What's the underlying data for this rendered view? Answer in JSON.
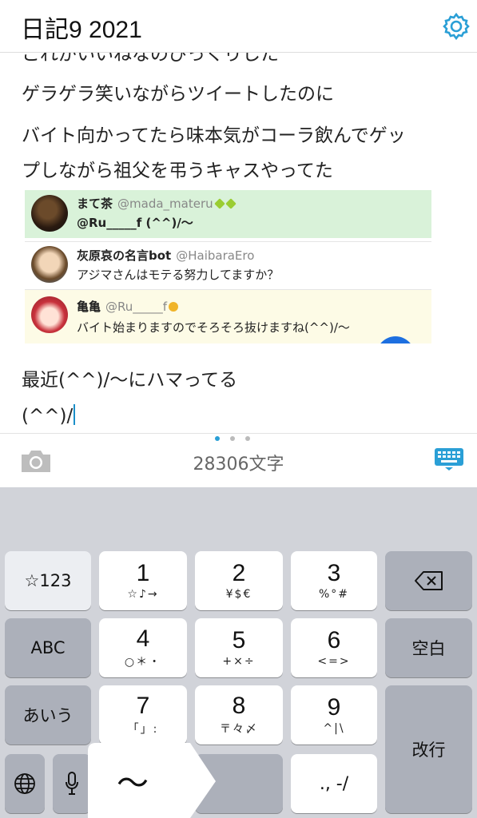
{
  "header": {
    "title": "日記9 2021",
    "settings_icon": "gear-icon"
  },
  "editor": {
    "lines": [
      "これがいいねなのびっくりした",
      "ゲラゲラ笑いながらツイートしたのに",
      "バイト向かってたら味本気がコーラ飲んでゲッ",
      "プしながら祖父を弔うキャスやってた",
      "最近(^^)/〜にハマってる",
      "(^^)/"
    ],
    "tweets": [
      {
        "name": "まて茶",
        "handle": "@mada_materu",
        "body": "@Ru_____f (^^)/〜"
      },
      {
        "name": "灰原哀の名言bot",
        "handle": "@HaibaraEro",
        "body": "アジマさんはモテる努力してますか？"
      },
      {
        "name": "亀亀",
        "handle": "@Ru_____f",
        "body": "バイト始まりますのでそろそろ抜けますね(^^)/〜"
      }
    ]
  },
  "toolbar": {
    "char_count": "28306文字",
    "camera_icon": "camera-icon",
    "keyboard_icon": "keyboard-icon",
    "page_dots": 3,
    "active_dot": 0
  },
  "keyboard": {
    "left": {
      "sym": "☆123",
      "abc": "ABC",
      "kana": "あいう"
    },
    "keys": [
      {
        "main": "1",
        "sub": "☆♪→"
      },
      {
        "main": "2",
        "sub": "¥$€"
      },
      {
        "main": "3",
        "sub": "%°#"
      },
      {
        "main": "4",
        "sub": "○＊・"
      },
      {
        "main": "5",
        "sub": "+×÷"
      },
      {
        "main": "6",
        "sub": "<=>"
      },
      {
        "main": "7",
        "sub": "「」:"
      },
      {
        "main": "8",
        "sub": "〒々〆"
      },
      {
        "main": "9",
        "sub": "^|\\"
      },
      {
        "main": "",
        "sub": "., -/"
      }
    ],
    "right": {
      "space": "空白",
      "return": "改行"
    },
    "popup_char": "〜"
  },
  "colors": {
    "accent": "#2a9fd6",
    "keyboard_bg": "#d1d3d9",
    "dark_key": "#acb0ba"
  }
}
